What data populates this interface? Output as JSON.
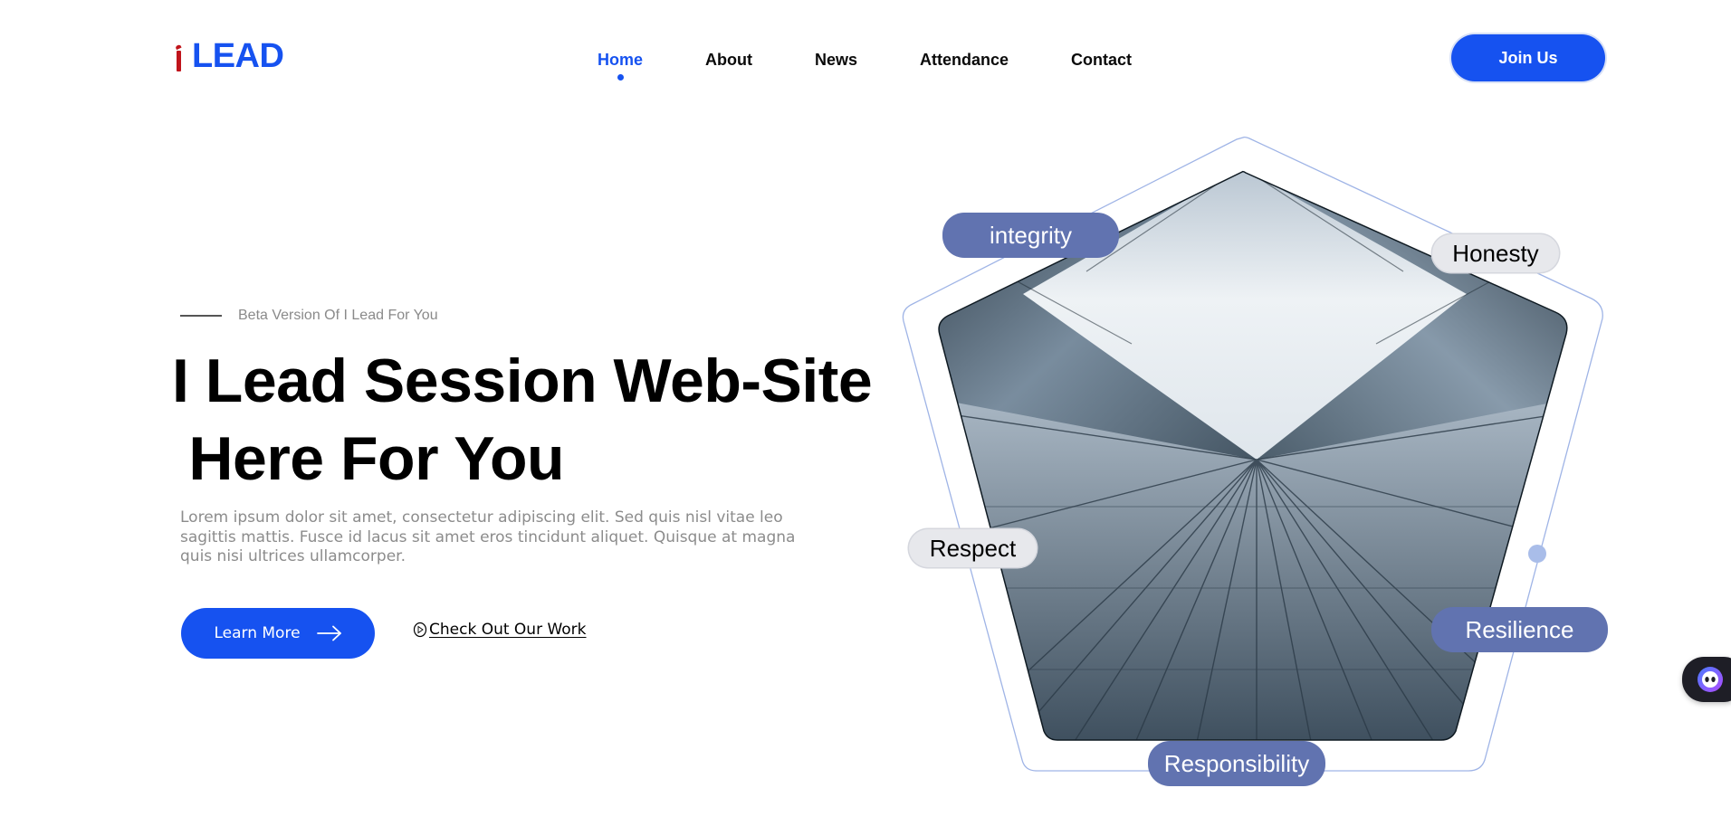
{
  "header": {
    "logo_text": "LEAD",
    "nav": [
      {
        "label": "Home",
        "active": true
      },
      {
        "label": "About",
        "active": false
      },
      {
        "label": "News",
        "active": false
      },
      {
        "label": "Attendance",
        "active": false
      },
      {
        "label": "Contact",
        "active": false
      }
    ],
    "join_label": "Join Us"
  },
  "hero": {
    "eyebrow": "Beta Version Of I Lead For You",
    "title_line1": "I Lead Session Web-Site",
    "title_line2": " Here For You",
    "description": "Lorem ipsum dolor sit amet, consectetur adipiscing elit. Sed quis nisl vitae leo sagittis mattis. Fusce id lacus sit amet eros tincidunt aliquet. Quisque at magna quis nisi ultrices ullamcorper.",
    "learn_more_label": "Learn More",
    "check_work_label": "Check Out Our Work"
  },
  "values": {
    "integrity": "integrity",
    "honesty": "Honesty",
    "respect": "Respect",
    "resilience": "Resilience",
    "responsibility": "Responsibility"
  },
  "colors": {
    "brand_blue": "#1652f0",
    "logo_red": "#c0141b",
    "pill_blue": "#6173b0",
    "outline_blue": "#9fb4e6"
  },
  "icons": {
    "learn_more": "arrow-right-icon",
    "check_work": "play-circle-icon",
    "chat": "chatbot-icon"
  }
}
